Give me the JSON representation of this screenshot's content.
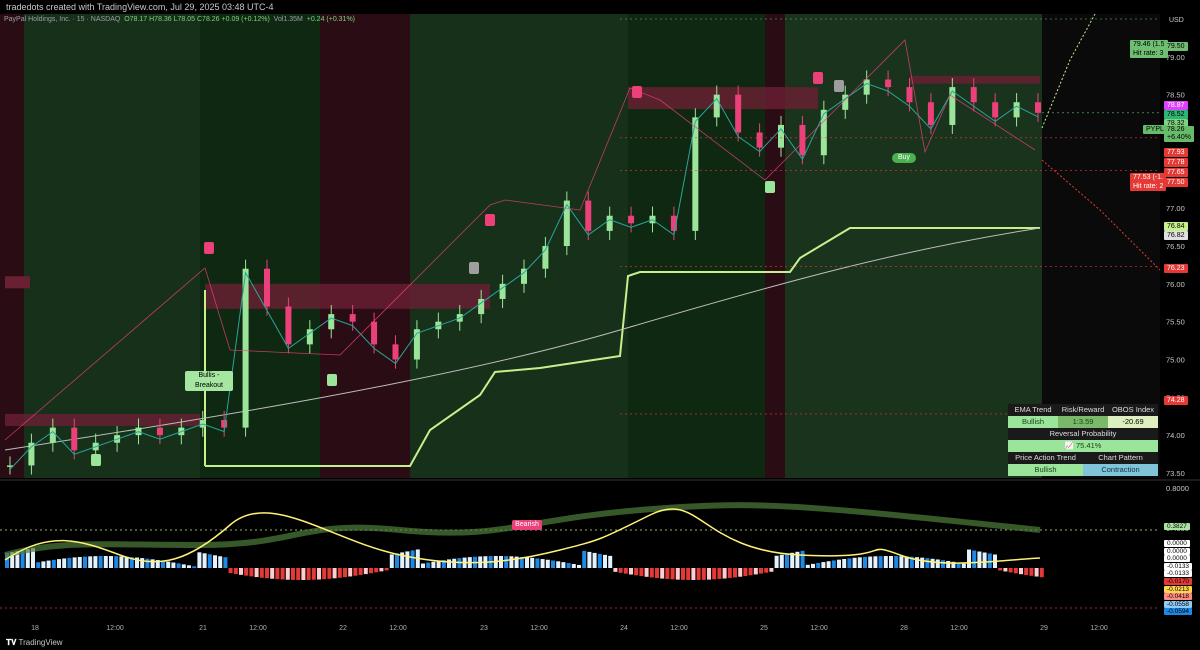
{
  "header": {
    "caption": "tradedots created with TradingView.com, Jul 29, 2025 03:48 UTC-4"
  },
  "legend": {
    "symbol": "PayPal Holdings, Inc. · 15 · NASDAQ",
    "ohlc": "O78.17  H78.36  L78.05  C78.26  +0.09 (+0.12%)",
    "vol": "Vol1.35M",
    "vol_chg": "+0.24 (+0.31%)"
  },
  "currency": "USD",
  "chart_data": {
    "type": "candlestick",
    "y_axis": {
      "min": 73.5,
      "max": 79.5,
      "ticks": [
        "79.50",
        "79.00",
        "78.50",
        "78.00",
        "77.50",
        "77.00",
        "76.50",
        "76.00",
        "75.50",
        "75.00",
        "74.50",
        "74.00",
        "73.50"
      ]
    },
    "x_ticks": [
      "18",
      "12:00",
      "21",
      "12:00",
      "22",
      "12:00",
      "23",
      "12:00",
      "24",
      "12:00",
      "25",
      "12:00",
      "28",
      "12:00",
      "29",
      "12:00"
    ],
    "closes": [
      73.6,
      73.9,
      74.1,
      73.8,
      73.9,
      74.0,
      74.1,
      74.0,
      74.1,
      74.2,
      74.1,
      76.2,
      75.7,
      75.2,
      75.4,
      75.6,
      75.5,
      75.2,
      75.0,
      75.4,
      75.5,
      75.6,
      75.8,
      76.0,
      76.2,
      76.5,
      77.1,
      76.7,
      76.9,
      76.8,
      76.9,
      76.7,
      78.2,
      78.5,
      78.0,
      77.8,
      78.1,
      77.7,
      78.3,
      78.5,
      78.7,
      78.6,
      78.4,
      78.1,
      78.6,
      78.4,
      78.2,
      78.4,
      78.26
    ],
    "osc_ticks": [
      "0.8000",
      "0.4000",
      "0.0000",
      "-0.4000"
    ],
    "osc_badges": [
      {
        "value": "0.3827",
        "color": "#a8e6a0"
      },
      {
        "value": "0.0000",
        "color": "#ffffff"
      },
      {
        "value": "0.0000",
        "color": "#ffffff"
      },
      {
        "value": "0.0000",
        "color": "#ffffff"
      },
      {
        "value": "-0.0133",
        "color": "#ffffff"
      },
      {
        "value": "-0.0133",
        "color": "#ffffff"
      },
      {
        "value": "-0.0170",
        "color": "#e53935"
      },
      {
        "value": "-0.0213",
        "color": "#ffd54f"
      },
      {
        "value": "-0.0418",
        "color": "#ff8a80"
      },
      {
        "value": "-0.0558",
        "color": "#90caf9"
      },
      {
        "value": "-0.0594",
        "color": "#1e88e5"
      }
    ]
  },
  "price_tags": {
    "target_up": "79.46 (1.5",
    "target_up2": "Hit rate: 3",
    "p7950": "79.50",
    "p7887": "78.87",
    "p7852": "78.52",
    "p7832": "78.32",
    "symbol_tag": "PYPL",
    "p7826": "78.26",
    "pct": "+6.40%",
    "p7793": "77.93",
    "p7878b": "77.78",
    "p7765": "77.65",
    "target_dn": "77.53 (-1.",
    "target_dn2": "Hit rate: 2",
    "p7750": "77.50",
    "p7684": "76.84",
    "p7682": "76.82",
    "p7623": "76.23",
    "p7428": "74.28"
  },
  "labels": {
    "bullish_breakout": "Bullis - Breakout",
    "buy": "Buy",
    "bearish": "Bearish"
  },
  "table": {
    "h1": "EMA Trend",
    "h2": "Risk/Reward",
    "h3": "OBOS Index",
    "v1": "Bullish",
    "v2": "1:3.59",
    "v3": "-20.69",
    "rp_label": "Reversal Probability",
    "rp_value": "75.41%",
    "h4": "Price Action Trend",
    "h5": "Chart Pattern",
    "v4": "Bullish",
    "v5": "Contraction"
  },
  "footer": {
    "brand": "TradingView"
  }
}
